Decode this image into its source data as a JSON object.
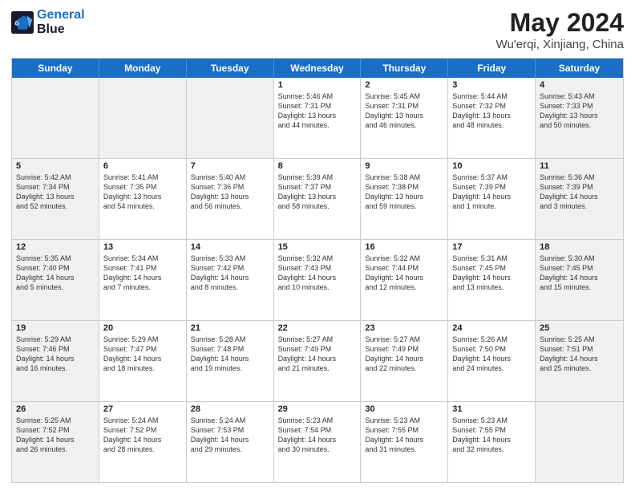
{
  "header": {
    "logo_line1": "General",
    "logo_line2": "Blue",
    "main_title": "May 2024",
    "subtitle": "Wu'erqi, Xinjiang, China"
  },
  "days_of_week": [
    "Sunday",
    "Monday",
    "Tuesday",
    "Wednesday",
    "Thursday",
    "Friday",
    "Saturday"
  ],
  "weeks": [
    [
      {
        "day": "",
        "info": "",
        "shaded": true
      },
      {
        "day": "",
        "info": "",
        "shaded": true
      },
      {
        "day": "",
        "info": "",
        "shaded": true
      },
      {
        "day": "1",
        "info": "Sunrise: 5:46 AM\nSunset: 7:31 PM\nDaylight: 13 hours\nand 44 minutes.",
        "shaded": false
      },
      {
        "day": "2",
        "info": "Sunrise: 5:45 AM\nSunset: 7:31 PM\nDaylight: 13 hours\nand 46 minutes.",
        "shaded": false
      },
      {
        "day": "3",
        "info": "Sunrise: 5:44 AM\nSunset: 7:32 PM\nDaylight: 13 hours\nand 48 minutes.",
        "shaded": false
      },
      {
        "day": "4",
        "info": "Sunrise: 5:43 AM\nSunset: 7:33 PM\nDaylight: 13 hours\nand 50 minutes.",
        "shaded": true
      }
    ],
    [
      {
        "day": "5",
        "info": "Sunrise: 5:42 AM\nSunset: 7:34 PM\nDaylight: 13 hours\nand 52 minutes.",
        "shaded": true
      },
      {
        "day": "6",
        "info": "Sunrise: 5:41 AM\nSunset: 7:35 PM\nDaylight: 13 hours\nand 54 minutes.",
        "shaded": false
      },
      {
        "day": "7",
        "info": "Sunrise: 5:40 AM\nSunset: 7:36 PM\nDaylight: 13 hours\nand 56 minutes.",
        "shaded": false
      },
      {
        "day": "8",
        "info": "Sunrise: 5:39 AM\nSunset: 7:37 PM\nDaylight: 13 hours\nand 58 minutes.",
        "shaded": false
      },
      {
        "day": "9",
        "info": "Sunrise: 5:38 AM\nSunset: 7:38 PM\nDaylight: 13 hours\nand 59 minutes.",
        "shaded": false
      },
      {
        "day": "10",
        "info": "Sunrise: 5:37 AM\nSunset: 7:39 PM\nDaylight: 14 hours\nand 1 minute.",
        "shaded": false
      },
      {
        "day": "11",
        "info": "Sunrise: 5:36 AM\nSunset: 7:39 PM\nDaylight: 14 hours\nand 3 minutes.",
        "shaded": true
      }
    ],
    [
      {
        "day": "12",
        "info": "Sunrise: 5:35 AM\nSunset: 7:40 PM\nDaylight: 14 hours\nand 5 minutes.",
        "shaded": true
      },
      {
        "day": "13",
        "info": "Sunrise: 5:34 AM\nSunset: 7:41 PM\nDaylight: 14 hours\nand 7 minutes.",
        "shaded": false
      },
      {
        "day": "14",
        "info": "Sunrise: 5:33 AM\nSunset: 7:42 PM\nDaylight: 14 hours\nand 8 minutes.",
        "shaded": false
      },
      {
        "day": "15",
        "info": "Sunrise: 5:32 AM\nSunset: 7:43 PM\nDaylight: 14 hours\nand 10 minutes.",
        "shaded": false
      },
      {
        "day": "16",
        "info": "Sunrise: 5:32 AM\nSunset: 7:44 PM\nDaylight: 14 hours\nand 12 minutes.",
        "shaded": false
      },
      {
        "day": "17",
        "info": "Sunrise: 5:31 AM\nSunset: 7:45 PM\nDaylight: 14 hours\nand 13 minutes.",
        "shaded": false
      },
      {
        "day": "18",
        "info": "Sunrise: 5:30 AM\nSunset: 7:45 PM\nDaylight: 14 hours\nand 15 minutes.",
        "shaded": true
      }
    ],
    [
      {
        "day": "19",
        "info": "Sunrise: 5:29 AM\nSunset: 7:46 PM\nDaylight: 14 hours\nand 16 minutes.",
        "shaded": true
      },
      {
        "day": "20",
        "info": "Sunrise: 5:29 AM\nSunset: 7:47 PM\nDaylight: 14 hours\nand 18 minutes.",
        "shaded": false
      },
      {
        "day": "21",
        "info": "Sunrise: 5:28 AM\nSunset: 7:48 PM\nDaylight: 14 hours\nand 19 minutes.",
        "shaded": false
      },
      {
        "day": "22",
        "info": "Sunrise: 5:27 AM\nSunset: 7:49 PM\nDaylight: 14 hours\nand 21 minutes.",
        "shaded": false
      },
      {
        "day": "23",
        "info": "Sunrise: 5:27 AM\nSunset: 7:49 PM\nDaylight: 14 hours\nand 22 minutes.",
        "shaded": false
      },
      {
        "day": "24",
        "info": "Sunrise: 5:26 AM\nSunset: 7:50 PM\nDaylight: 14 hours\nand 24 minutes.",
        "shaded": false
      },
      {
        "day": "25",
        "info": "Sunrise: 5:25 AM\nSunset: 7:51 PM\nDaylight: 14 hours\nand 25 minutes.",
        "shaded": true
      }
    ],
    [
      {
        "day": "26",
        "info": "Sunrise: 5:25 AM\nSunset: 7:52 PM\nDaylight: 14 hours\nand 26 minutes.",
        "shaded": true
      },
      {
        "day": "27",
        "info": "Sunrise: 5:24 AM\nSunset: 7:52 PM\nDaylight: 14 hours\nand 28 minutes.",
        "shaded": false
      },
      {
        "day": "28",
        "info": "Sunrise: 5:24 AM\nSunset: 7:53 PM\nDaylight: 14 hours\nand 29 minutes.",
        "shaded": false
      },
      {
        "day": "29",
        "info": "Sunrise: 5:23 AM\nSunset: 7:54 PM\nDaylight: 14 hours\nand 30 minutes.",
        "shaded": false
      },
      {
        "day": "30",
        "info": "Sunrise: 5:23 AM\nSunset: 7:55 PM\nDaylight: 14 hours\nand 31 minutes.",
        "shaded": false
      },
      {
        "day": "31",
        "info": "Sunrise: 5:23 AM\nSunset: 7:55 PM\nDaylight: 14 hours\nand 32 minutes.",
        "shaded": false
      },
      {
        "day": "",
        "info": "",
        "shaded": true
      }
    ]
  ]
}
